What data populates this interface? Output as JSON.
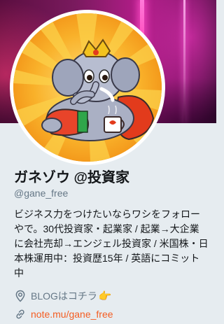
{
  "profile": {
    "display_name": "ガネゾウ @投資家",
    "handle": "@gane_free",
    "bio": "ビジネス力をつけたいならワシをフォローやで。30代投資家・起業家 / 起業→大企業に会社売却→エンジェル投資家 / 米国株・日本株運用中：投資歴15年 / 英語にコミット中",
    "location": "BLOGはコチラ",
    "location_emoji": "👉",
    "url_text": "note.mu/gane_free"
  },
  "icons": {
    "location": "map-pin-icon",
    "link": "link-icon"
  },
  "colors": {
    "link": "#f45d22",
    "secondary_text": "#657786",
    "primary_text": "#14171a",
    "background": "#e6ecf0"
  }
}
